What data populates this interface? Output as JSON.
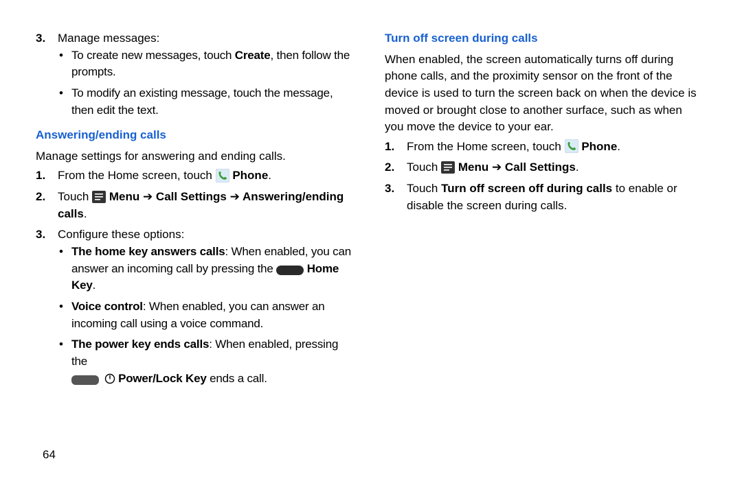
{
  "page_number": "64",
  "left": {
    "step3_label": "3.",
    "step3_text": "Manage messages:",
    "step3_bullets": [
      {
        "pre": "To create new messages, touch ",
        "bold": "Create",
        "post": ", then follow the prompts."
      },
      {
        "pre": "To modify an existing message, touch the message, then edit the text.",
        "bold": "",
        "post": ""
      }
    ],
    "heading_a": "Answering/ending calls",
    "intro_a": "Manage settings for answering and ending calls.",
    "steps_a": {
      "s1_num": "1.",
      "s1_pre": "From the Home screen, touch ",
      "s1_post": " Phone",
      "s1_dot": ".",
      "s2_num": "2.",
      "s2_pre": "Touch ",
      "s2_menu": " Menu ",
      "s2_arrow1": "➔",
      "s2_cs": " Call Settings ",
      "s2_arrow2": "➔",
      "s2_ae": " Answering/ending calls",
      "s2_dot": ".",
      "s3_num": "3.",
      "s3_text": "Configure these options:"
    },
    "options": {
      "o1_bold": "The home key answers calls",
      "o1_text1": ": When enabled, you can answer an incoming call by pressing the ",
      "o1_homekey": " Home Key",
      "o1_dot": ".",
      "o2_bold": "Voice control",
      "o2_text": ": When enabled, you can answer an incoming call using a voice command.",
      "o3_bold": "The power key ends calls",
      "o3_text1": ": When enabled, pressing the ",
      "o3_powerkey": " Power/Lock Key",
      "o3_text2": " ends a call."
    }
  },
  "right": {
    "heading_b": "Turn off screen during calls",
    "intro_b": "When enabled, the screen automatically turns off during phone calls, and the proximity sensor on the front of the device is used to turn the screen back on when the device is moved or brought close to another surface, such as when you move the device to your ear.",
    "steps_b": {
      "s1_num": "1.",
      "s1_pre": "From the Home screen, touch ",
      "s1_post": " Phone",
      "s1_dot": ".",
      "s2_num": "2.",
      "s2_pre": "Touch ",
      "s2_menu": " Menu ",
      "s2_arrow": "➔",
      "s2_cs": " Call Settings",
      "s2_dot": ".",
      "s3_num": "3.",
      "s3_pre": "Touch ",
      "s3_bold": "Turn off screen off during calls",
      "s3_post": " to enable or disable the screen during calls."
    }
  }
}
